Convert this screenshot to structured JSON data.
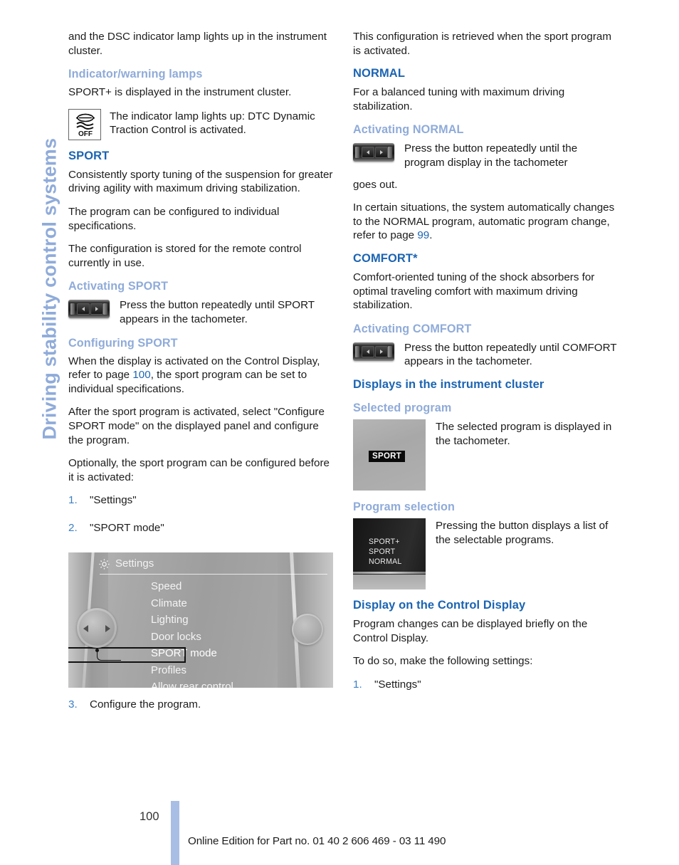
{
  "chapter": {
    "vertical_title": "Driving stability control systems"
  },
  "left_column": {
    "intro_paragraph": "and the DSC indicator lamp lights up in the instrument cluster.",
    "indicator_heading": "Indicator/warning lamps",
    "indicator_paragraph": "SPORT+ is displayed in the instrument cluster.",
    "lamp_icon_label": "OFF",
    "lamp_caption": "The indicator lamp lights up: DTC Dynamic Traction Control is activated.",
    "sport_heading": "SPORT",
    "sport_p1": "Consistently sporty tuning of the suspension for greater driving agility with maximum driving stabilization.",
    "sport_p2": "The program can be configured to individual specifications.",
    "sport_p3": "The configuration is stored for the remote control currently in use.",
    "activating_sport_heading": "Activating SPORT",
    "activating_sport_caption": "Press the button repeatedly until SPORT appears in the tachometer.",
    "configuring_sport_heading": "Configuring SPORT",
    "configuring_p1_before": "When the display is activated on the Control Display, refer to page ",
    "configuring_p1_pageref": "100",
    "configuring_p1_after": ", the sport program can be set to individual specifications.",
    "configuring_p2": "After the sport program is activated, select \"Configure SPORT mode\" on the displayed panel and configure the program.",
    "configuring_p3": "Optionally, the sport program can be configured before it is activated:",
    "steps": [
      {
        "num": "1.",
        "text": "\"Settings\""
      },
      {
        "num": "2.",
        "text": "\"SPORT mode\""
      }
    ],
    "step3": {
      "num": "3.",
      "text": "Configure the program."
    },
    "idrive": {
      "title": "Settings",
      "items": [
        "Speed",
        "Climate",
        "Lighting",
        "Door locks",
        "SPORT mode",
        "Profiles",
        "Allow rear control"
      ],
      "selected_item": "SPORT mode"
    }
  },
  "right_column": {
    "retrieved_paragraph": "This configuration is retrieved when the sport program is activated.",
    "normal_heading": "NORMAL",
    "normal_p1": "For a balanced tuning with maximum driving stabilization.",
    "activating_normal_heading": "Activating NORMAL",
    "activating_normal_caption": "Press the button repeatedly until the program display in the tachometer",
    "activating_normal_caption_tail": "goes out.",
    "auto_change_before": "In certain situations, the system automatically changes to the NORMAL program, automatic program change, refer to page ",
    "auto_change_pageref": "99",
    "auto_change_after": ".",
    "comfort_heading": "COMFORT*",
    "comfort_p1": "Comfort-oriented tuning of the shock absorbers for optimal traveling comfort with maximum driving stabilization.",
    "activating_comfort_heading": "Activating COMFORT",
    "activating_comfort_caption": "Press the button repeatedly until COMFORT appears in the tachometer.",
    "displays_heading": "Displays in the instrument cluster",
    "selected_program_heading": "Selected program",
    "selected_program_caption": "The selected program is displayed in the tachometer.",
    "selected_program_badge": "SPORT",
    "program_selection_heading": "Program selection",
    "program_selection_caption": "Pressing the button displays a list of the selectable programs.",
    "program_selection_list": [
      "SPORT+",
      "SPORT",
      "NORMAL"
    ],
    "control_display_heading": "Display on the Control Display",
    "control_display_p1": "Program changes can be displayed briefly on the Control Display.",
    "control_display_p2": "To do so, make the following settings:",
    "control_display_steps": [
      {
        "num": "1.",
        "text": "\"Settings\""
      }
    ]
  },
  "footer": {
    "page_number": "100",
    "note": "Online Edition for Part no. 01 40 2 606 469 - 03 11 490"
  },
  "colors": {
    "heading_dark_blue": "#1B64B2",
    "heading_light_blue": "#8FABD9",
    "page_bar": "#A9BEE4",
    "step_number": "#3C7FC4"
  }
}
